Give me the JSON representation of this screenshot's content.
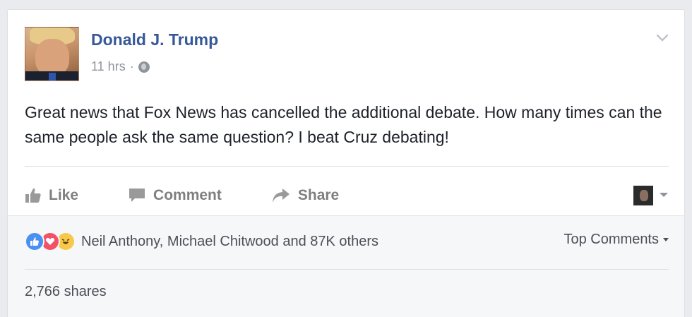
{
  "post": {
    "author": "Donald J. Trump",
    "time": "11 hrs",
    "separator": "·",
    "privacy_icon": "globe-icon",
    "text": "Great news that Fox News has cancelled the additional debate. How many times can the same people ask the same question? I beat Cruz debating!"
  },
  "actions": {
    "like": "Like",
    "comment": "Comment",
    "share": "Share"
  },
  "footer": {
    "reactions": [
      "like",
      "love",
      "haha"
    ],
    "reactors": "Neil Anthony, Michael Chitwood and 87K others",
    "top_comments": "Top Comments",
    "shares": "2,766 shares"
  },
  "colors": {
    "link": "#365899",
    "muted": "#90949c",
    "text": "#1d2129",
    "like": "#4a90f3",
    "love": "#f25268",
    "haha": "#f7c94a"
  }
}
